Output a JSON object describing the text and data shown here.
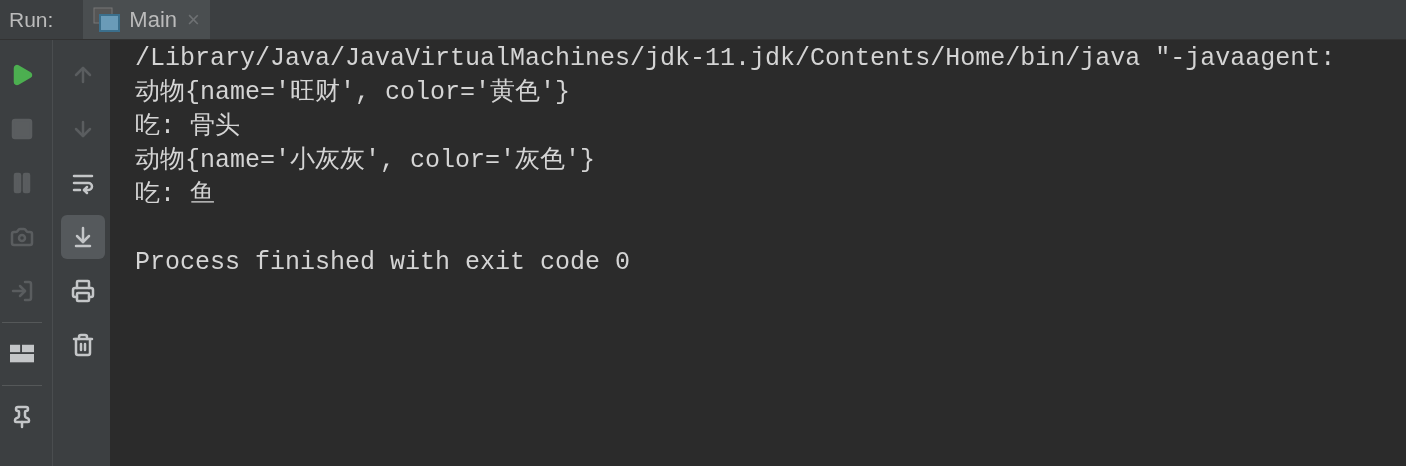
{
  "header": {
    "label": "Run:",
    "tabs": [
      {
        "label": "Main",
        "selected": true,
        "close": "×"
      }
    ]
  },
  "toolbar": {
    "left": [
      {
        "kind": "run",
        "disabled": false
      },
      {
        "kind": "stop",
        "disabled": true
      },
      {
        "kind": "pause",
        "disabled": true
      },
      {
        "kind": "camera",
        "disabled": true
      },
      {
        "kind": "exit",
        "disabled": true
      },
      {
        "kind": "separator"
      },
      {
        "kind": "layout",
        "disabled": false
      },
      {
        "kind": "separator"
      },
      {
        "kind": "pin",
        "disabled": false
      }
    ],
    "right": [
      {
        "kind": "up",
        "disabled": true,
        "selected": false
      },
      {
        "kind": "down",
        "disabled": true,
        "selected": false
      },
      {
        "kind": "wrap",
        "disabled": false,
        "selected": false
      },
      {
        "kind": "scroll-end",
        "disabled": false,
        "selected": true
      },
      {
        "kind": "print",
        "disabled": false,
        "selected": false
      },
      {
        "kind": "trash",
        "disabled": false,
        "selected": false
      }
    ]
  },
  "console": {
    "lines": [
      "/Library/Java/JavaVirtualMachines/jdk-11.jdk/Contents/Home/bin/java \"-javaagent:",
      "动物{name='旺财', color='黄色'}",
      "吃: 骨头",
      "动物{name='小灰灰', color='灰色'}",
      "吃: 鱼"
    ],
    "exit_message": "Process finished with exit code 0"
  }
}
